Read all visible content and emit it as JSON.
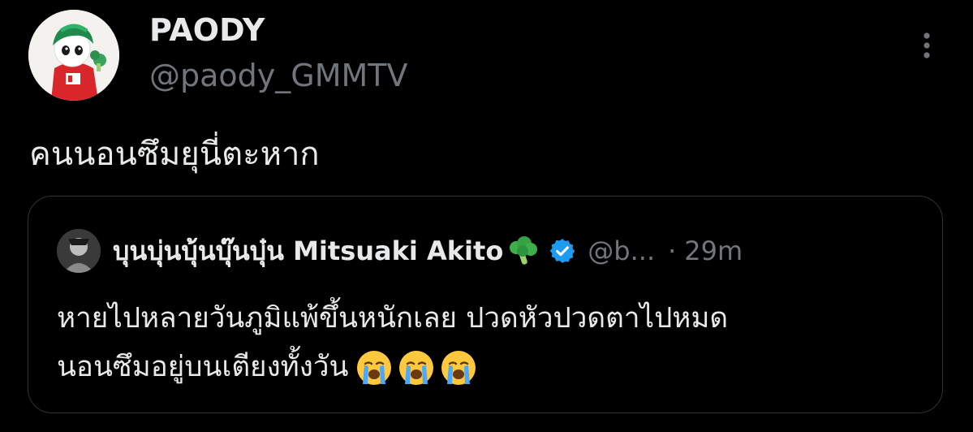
{
  "author": {
    "display_name": "PAODY",
    "handle": "@paody_GMMTV",
    "avatar": "mascot-avatar"
  },
  "tweet": {
    "text": "คนนอนซึมยุนี่ตะหาก"
  },
  "quoted": {
    "display_name": "บุนบุ่นบุ้นบุ๊นบุ๋น Mitsuaki Akito",
    "name_emoji": "broccoli-icon",
    "verified_icon": "verified-badge-icon",
    "handle": "@b...",
    "separator": "·",
    "time": "29m",
    "text_line1": "หายไปหลายวันภูมิแพ้ขึ้นหนักเลย ปวดหัวปวดตาไปหมด",
    "text_line2": "นอนซึมอยู่บนเตียงทั้งวัน",
    "trailing_emojis": [
      "loudly-crying-face-icon",
      "loudly-crying-face-icon",
      "loudly-crying-face-icon"
    ]
  },
  "colors": {
    "background": "#000000",
    "text_primary": "#e7e9ea",
    "text_secondary": "#71767b",
    "border": "#2f3336",
    "verified_blue": "#1d9bf0"
  },
  "icons": {
    "more": "more-options-icon"
  }
}
